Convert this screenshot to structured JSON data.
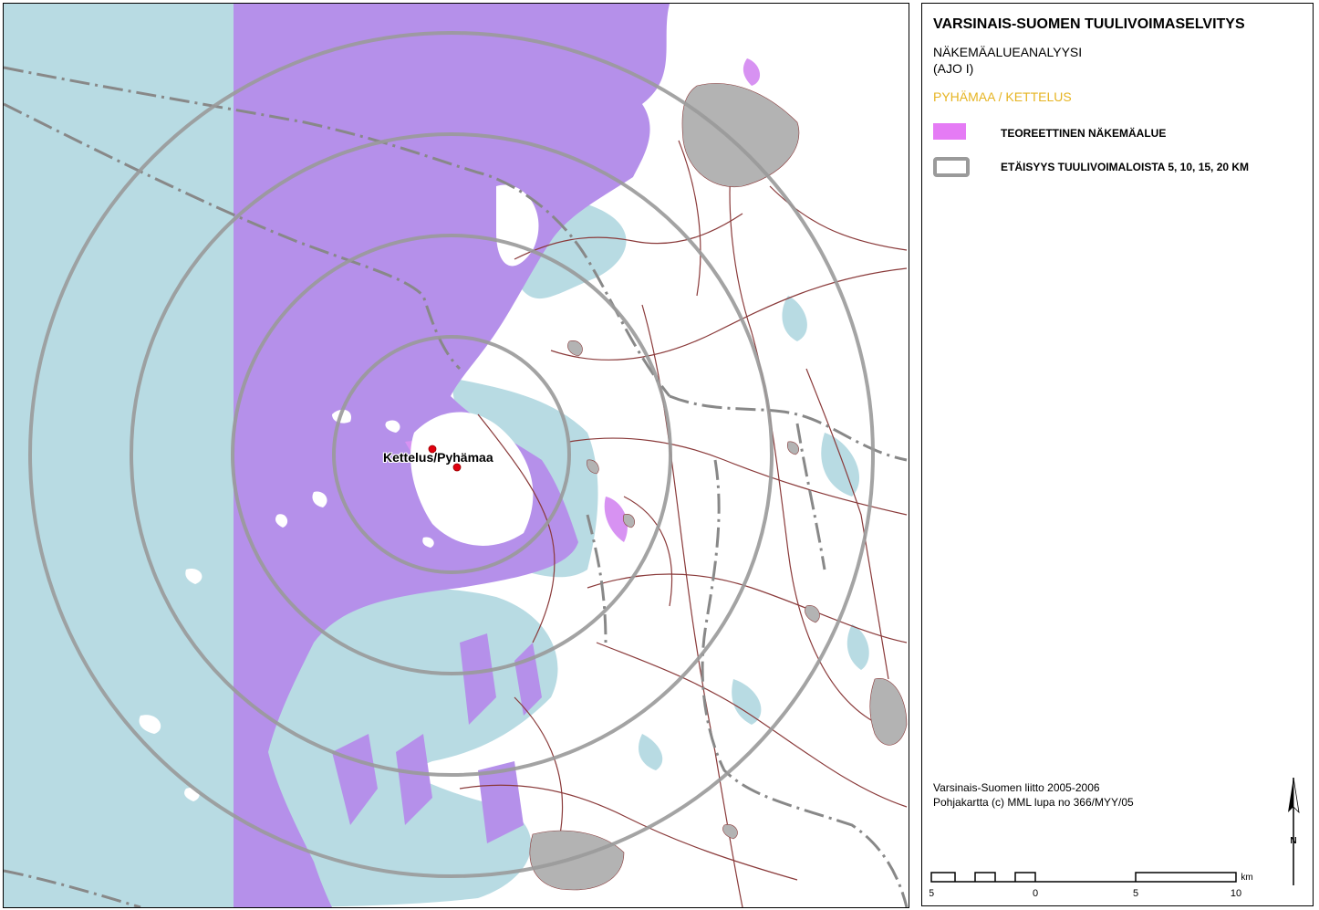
{
  "legend": {
    "title": "VARSINAIS-SUOMEN TUULIVOIMASELVITYS",
    "subtitle_line1": "NÄKEMÄALUEANALYYSI",
    "subtitle_line2": "(AJO I)",
    "site_name": "PYHÄMAA / KETTELUS",
    "items": [
      {
        "label": "TEOREETTINEN NÄKEMÄALUE",
        "color": "#e57bf5",
        "icon": "fill-swatch"
      },
      {
        "label": "ETÄISYYS TUULIVOIMALOISTA 5, 10, 15, 20 KM",
        "color": "#9a9a9a",
        "icon": "ring-swatch"
      }
    ]
  },
  "credits": {
    "line1": "Varsinais-Suomen liitto 2005-2006",
    "line2": "Pohjakartta (c) MML lupa no 366/MYY/05"
  },
  "north_arrow": {
    "letter": "N",
    "icon": "north-arrow-icon"
  },
  "scale_bar": {
    "unit": "km",
    "ticks": [
      "5",
      "0",
      "5",
      "10"
    ]
  },
  "map": {
    "site_label": "Kettelus/Pyhämaa",
    "ring_distances_km": [
      5,
      10,
      15,
      20
    ],
    "colors": {
      "sea": "#b8dbe3",
      "visibility": "#b590ea",
      "visibility_bright": "#d792f2",
      "land": "#ffffff",
      "road": "#8a3a3a",
      "urban": "#b3b3b3",
      "ring": "#9a9a9a",
      "turbine": "#e0000f"
    }
  }
}
